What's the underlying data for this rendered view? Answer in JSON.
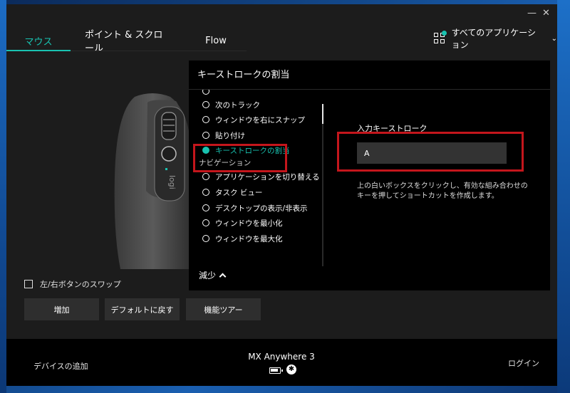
{
  "titlebar": {
    "minimize": "—",
    "close": "✕"
  },
  "tabs": [
    {
      "label": "マウス",
      "active": true
    },
    {
      "label": "ポイント & スクロール",
      "active": false
    },
    {
      "label": "Flow",
      "active": false
    }
  ],
  "app_selector": {
    "label": "すべてのアプリケーション",
    "icon": "apps-grid-icon"
  },
  "left_panel": {
    "swap_label": "左/右ボタンのスワップ",
    "buttons": {
      "add": "増加",
      "reset_default": "デフォルトに戻す",
      "feature_tour": "機能ツアー"
    }
  },
  "footer": {
    "add_device": "デバイスの追加",
    "device_name": "MX Anywhere 3",
    "login": "ログイン"
  },
  "modal": {
    "title": "キーストロークの割当",
    "items": [
      {
        "label": "次のトラック",
        "selected": false
      },
      {
        "label": "ウィンドウを右にスナップ",
        "selected": false
      },
      {
        "label": "貼り付け",
        "selected": false
      },
      {
        "label": "キーストロークの割当",
        "selected": true
      }
    ],
    "section_label": "ナビゲーション",
    "nav_items": [
      {
        "label": "アプリケーションを切り替える"
      },
      {
        "label": "タスク ビュー"
      },
      {
        "label": "デスクトップの表示/非表示"
      },
      {
        "label": "ウィンドウを最小化"
      },
      {
        "label": "ウィンドウを最大化"
      }
    ],
    "collapse_label": "減少",
    "input_label": "入力キーストローク",
    "input_value": "A",
    "hint": "上の白いボックスをクリックし、有効な組み合わせのキーを押してショートカットを作成します。"
  },
  "colors": {
    "accent": "#19c2b0",
    "highlight": "#c4161c",
    "window_bg": "#1c1c1c",
    "modal_bg": "#000000"
  }
}
